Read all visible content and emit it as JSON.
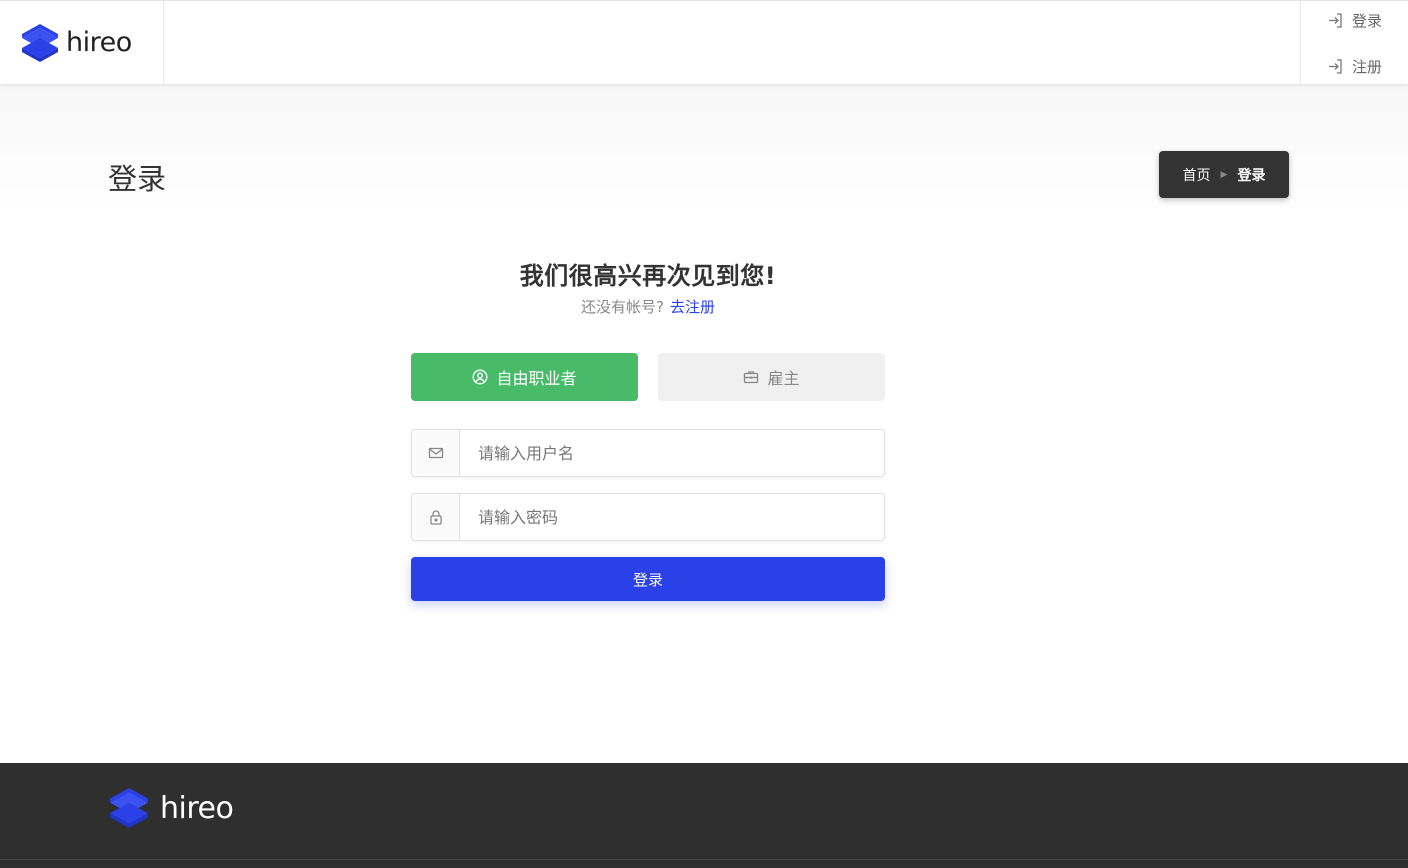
{
  "brand": {
    "name": "hireo",
    "accent": "#2a41e8"
  },
  "header": {
    "login_label": "登录",
    "register_label": "注册"
  },
  "titlebar": {
    "title": "登录",
    "breadcrumb": {
      "home": "首页",
      "current": "登录"
    }
  },
  "login": {
    "heading": "我们很高兴再次见到您!",
    "no_account": "还没有帐号?",
    "register_link": "去注册",
    "roles": [
      {
        "label": "自由职业者",
        "icon": "user-circle-icon",
        "active": true,
        "color": "#47bb67"
      },
      {
        "label": "雇主",
        "icon": "briefcase-icon",
        "active": false,
        "color": "#f0f0f0"
      }
    ],
    "username_placeholder": "请输入用户名",
    "password_placeholder": "请输入密码",
    "submit_label": "登录"
  },
  "footer": {
    "brand": "hireo",
    "bg": "#2f2f2f"
  }
}
